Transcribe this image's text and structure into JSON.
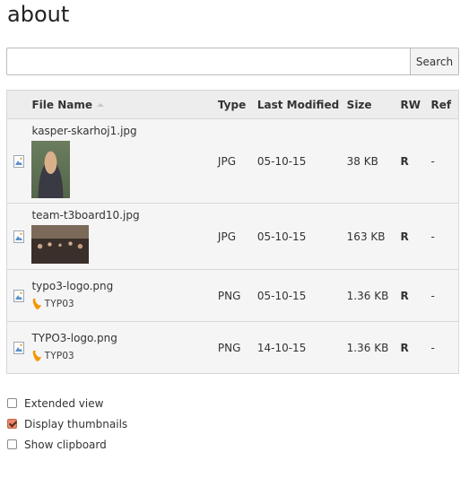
{
  "page": {
    "title": "about"
  },
  "search": {
    "value": "",
    "placeholder": "",
    "button_label": "Search"
  },
  "table": {
    "columns": {
      "name": "File Name",
      "type": "Type",
      "modified": "Last Modified",
      "size": "Size",
      "rw": "RW",
      "ref": "Ref"
    },
    "sort": {
      "column": "File Name",
      "direction": "ascending"
    },
    "rows": [
      {
        "name": "kasper-skarhoj1.jpg",
        "type": "JPG",
        "modified": "05-10-15",
        "size": "38 KB",
        "rw": "R",
        "ref": "-",
        "thumbnail": "portrait-photo"
      },
      {
        "name": "team-t3board10.jpg",
        "type": "JPG",
        "modified": "05-10-15",
        "size": "163 KB",
        "rw": "R",
        "ref": "-",
        "thumbnail": "group-photo"
      },
      {
        "name": "typo3-logo.png",
        "type": "PNG",
        "modified": "05-10-15",
        "size": "1.36 KB",
        "rw": "R",
        "ref": "-",
        "thumbnail": "typo3-logo",
        "logo_text": "TYPO3"
      },
      {
        "name": "TYPO3-logo.png",
        "type": "PNG",
        "modified": "14-10-15",
        "size": "1.36 KB",
        "rw": "R",
        "ref": "-",
        "thumbnail": "typo3-logo",
        "logo_text": "TYPO3"
      }
    ]
  },
  "options": {
    "extended_view": {
      "label": "Extended view",
      "checked": false
    },
    "display_thumbnails": {
      "label": "Display thumbnails",
      "checked": true
    },
    "show_clipboard": {
      "label": "Show clipboard",
      "checked": false
    }
  },
  "colors": {
    "rw_readonly": "#c83c3c",
    "typo3_orange": "#f49700",
    "checkbox_checked": "#e8896c",
    "header_bg": "#ededed",
    "row_bg": "#f5f5f5"
  },
  "icons": [
    "image-file-icon",
    "typo3-logo-icon",
    "sort-ascending-icon"
  ]
}
